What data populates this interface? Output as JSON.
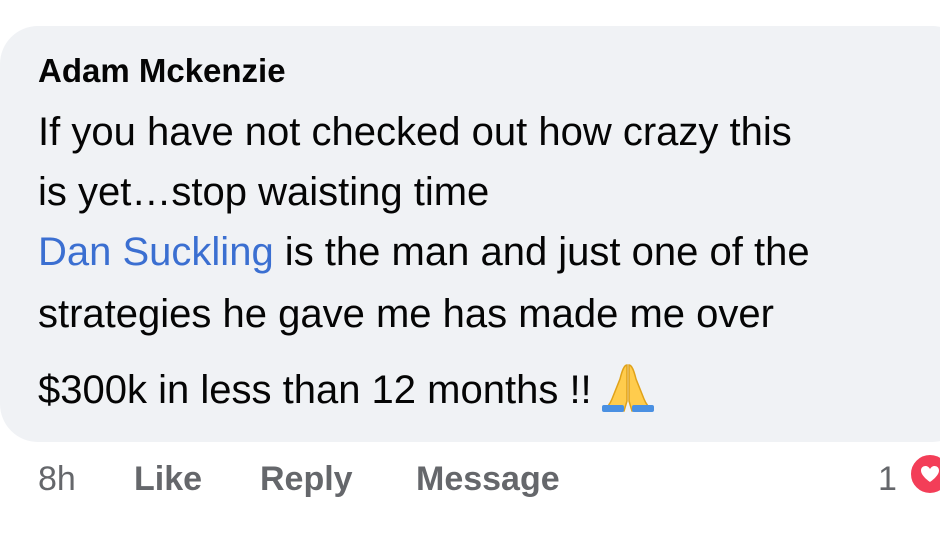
{
  "comment": {
    "author": "Adam Mckenzie",
    "line1": "If you have not checked out how crazy this",
    "line2": "is yet…stop waisting time",
    "mention": "Dan Suckling",
    "line3_rest": " is the man and just one of the",
    "line4": "strategies he gave me has made me over",
    "line5": "$300k in less than 12 months !!",
    "emoji": "🙏"
  },
  "actions": {
    "timestamp": "8h",
    "like_label": "Like",
    "reply_label": "Reply",
    "message_label": "Message"
  },
  "reactions": {
    "count": "1",
    "icon": "heart-icon",
    "color": "#f33e58"
  },
  "colors": {
    "bubble_bg": "#f0f2f5",
    "mention": "#3b6fd1",
    "secondary_text": "#65676b"
  }
}
